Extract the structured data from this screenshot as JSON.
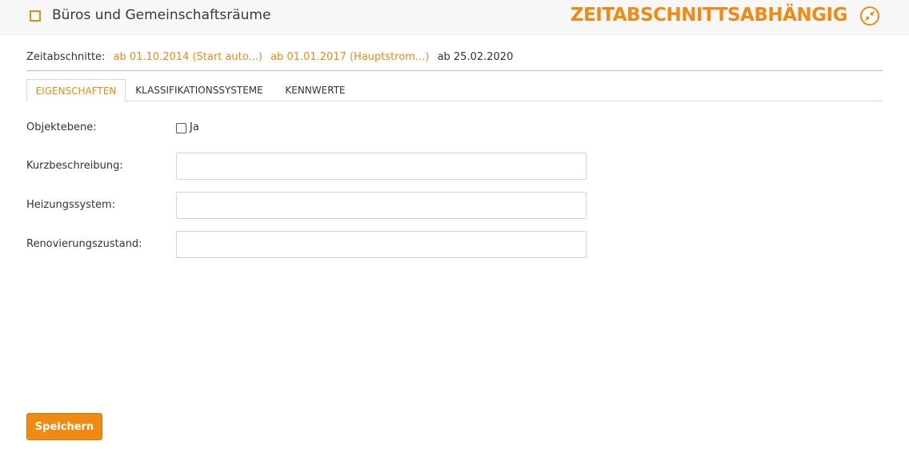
{
  "header": {
    "title": "Büros und Gemeinschaftsräume",
    "title_icon": "square-outline-icon",
    "section_title": "ZEITABSCHNITTSABHÄNGIG",
    "collapse_icon": "collapse-arrows-icon"
  },
  "periods": {
    "label": "Zeitabschnitte:",
    "links": [
      "ab 01.10.2014 (Start auto...)",
      "ab 01.01.2017 (Hauptstrom...)"
    ],
    "current": "ab 25.02.2020"
  },
  "tabs": [
    {
      "label": "EIGENSCHAFTEN",
      "active": true
    },
    {
      "label": "KLASSIFIKATIONSSYSTEME",
      "active": false
    },
    {
      "label": "KENNWERTE",
      "active": false
    }
  ],
  "form": {
    "objektebene": {
      "label": "Objektebene:",
      "checkbox_label": "Ja",
      "checked": false
    },
    "kurzbeschreibung": {
      "label": "Kurzbeschreibung:",
      "value": ""
    },
    "heizungssystem": {
      "label": "Heizungssystem:",
      "value": ""
    },
    "renovierungszustand": {
      "label": "Renovierungszustand:",
      "value": ""
    }
  },
  "actions": {
    "save_label": "Speichern"
  },
  "colors": {
    "accent": "#f08a12",
    "text": "#333333",
    "header_bg": "#f7f7f7"
  }
}
